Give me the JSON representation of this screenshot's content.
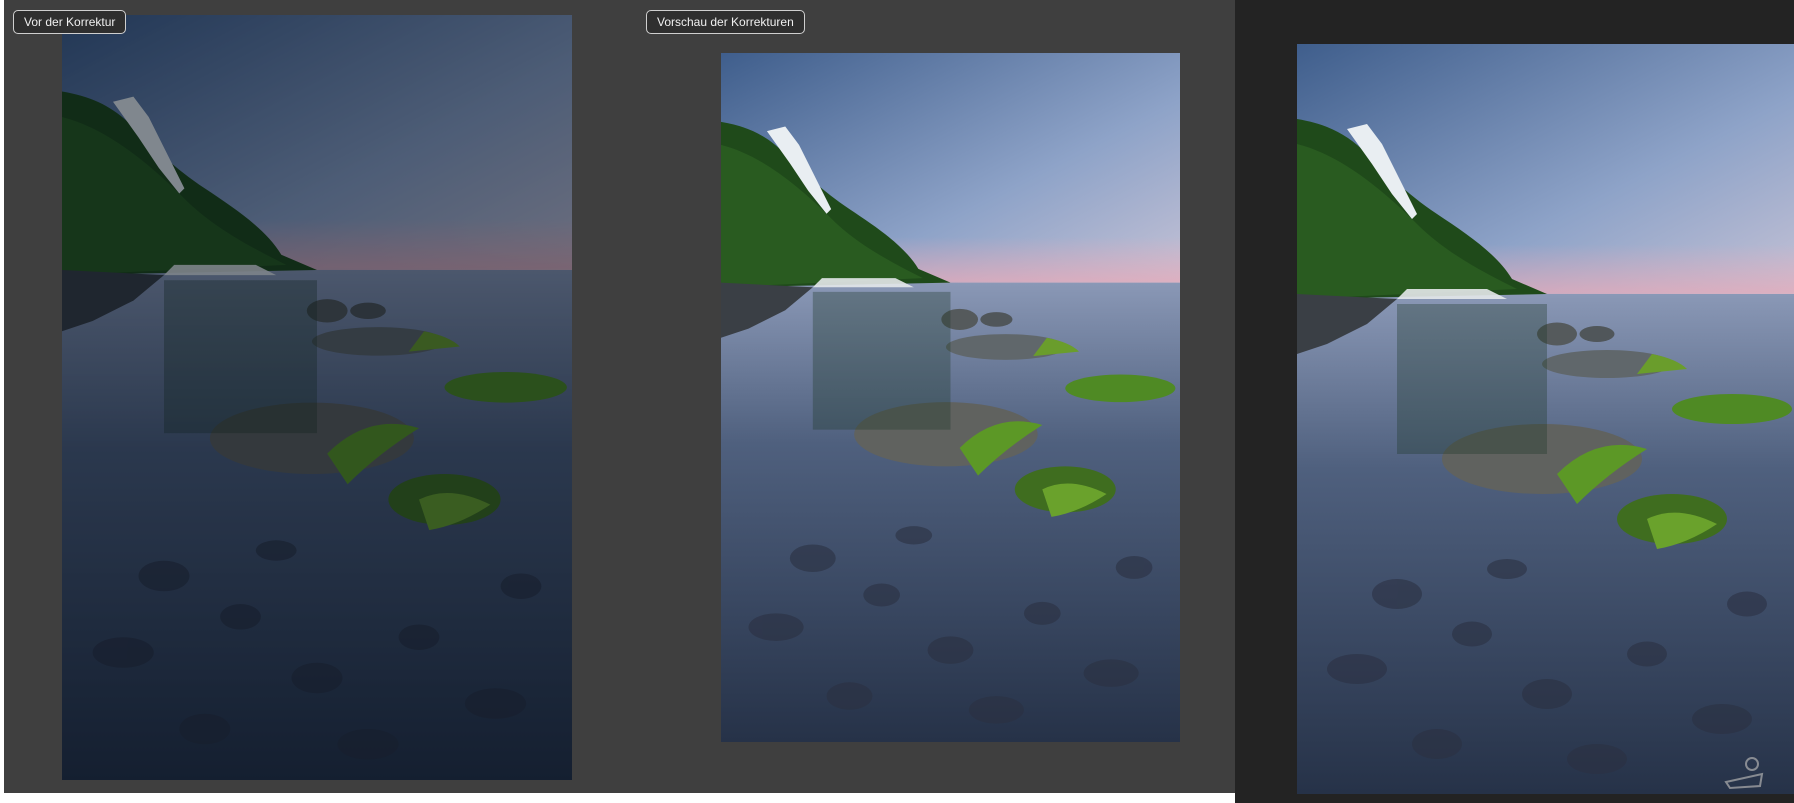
{
  "compare": {
    "before_label": "Vor der Korrektur",
    "after_label": "Vorschau der Korrekturen"
  },
  "colors": {
    "panel_bg": "#3f3f3f",
    "preview_bg": "#232323",
    "label_border": "#cfcfcf"
  }
}
